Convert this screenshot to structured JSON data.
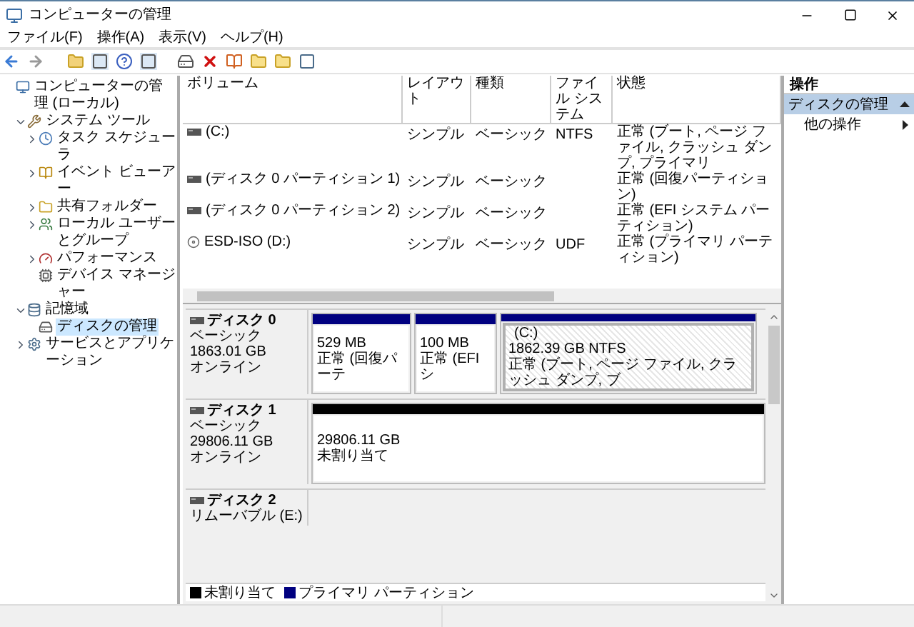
{
  "window": {
    "title": "コンピューターの管理"
  },
  "menu": [
    "ファイル(F)",
    "操作(A)",
    "表示(V)",
    "ヘルプ(H)"
  ],
  "tree": [
    {
      "label": "コンピューターの管理 (ローカル)",
      "selected": false,
      "children": [
        {
          "label": "システム ツール",
          "expanded": true,
          "selected": false,
          "children": [
            {
              "label": "タスク スケジューラ",
              "expanded": false,
              "selected": false
            },
            {
              "label": "イベント ビューアー",
              "expanded": false,
              "selected": false
            },
            {
              "label": "共有フォルダー",
              "expanded": false,
              "selected": false
            },
            {
              "label": "ローカル ユーザーとグループ",
              "expanded": false,
              "selected": false
            },
            {
              "label": "パフォーマンス",
              "expanded": false,
              "selected": false
            },
            {
              "label": "デバイス マネージャー",
              "selected": false
            }
          ]
        },
        {
          "label": "記憶域",
          "expanded": true,
          "selected": false,
          "children": [
            {
              "label": "ディスクの管理",
              "selected": true
            }
          ]
        },
        {
          "label": "サービスとアプリケーション",
          "expanded": false,
          "selected": false
        }
      ]
    }
  ],
  "volumes": {
    "columns": [
      "ボリューム",
      "レイアウト",
      "種類",
      "ファイル システム",
      "状態"
    ],
    "rows": [
      {
        "kind": "disk",
        "volume": "(C:)",
        "layout": "シンプル",
        "type": "ベーシック",
        "fs": "NTFS",
        "status": "正常 (ブート, ページ ファイル, クラッシュ ダンプ, プライマリ"
      },
      {
        "kind": "disk",
        "volume": "(ディスク 0 パーティション 1)",
        "layout": "シンプル",
        "type": "ベーシック",
        "status": "正常 (回復パーティション)"
      },
      {
        "kind": "disk",
        "volume": "(ディスク 0 パーティション 2)",
        "layout": "シンプル",
        "type": "ベーシック",
        "status": "正常 (EFI システム パーティション)"
      },
      {
        "kind": "cdrom",
        "volume": "ESD-ISO (D:)",
        "layout": "シンプル",
        "type": "ベーシック",
        "fs": "UDF",
        "status": "正常 (プライマリ パーティション)"
      }
    ]
  },
  "disks": [
    {
      "name": "ディスク 0",
      "type": "ベーシック",
      "size": "1863.01 GB",
      "status": "オンライン",
      "partitions": [
        {
          "kind": "primary",
          "size": "529 MB",
          "status": "正常 (回復パーテ",
          "selected": false
        },
        {
          "kind": "primary",
          "size": "100 MB",
          "status": "正常 (EFI シ",
          "selected": false
        },
        {
          "kind": "primary",
          "label": "(C:)",
          "size": "1862.39 GB NTFS",
          "status": "正常 (ブート, ページ ファイル, クラッシュ ダンプ, ブ",
          "selected": true
        }
      ]
    },
    {
      "name": "ディスク 1",
      "type": "ベーシック",
      "size": "29806.11 GB",
      "status": "オンライン",
      "partitions": [
        {
          "kind": "unallocated",
          "size": "29806.11 GB",
          "status": "未割り当て",
          "selected": false
        }
      ]
    },
    {
      "name": "ディスク 2",
      "type": "リムーバブル (E:)"
    }
  ],
  "legend": [
    {
      "kind": "unallocated",
      "label": "未割り当て",
      "color": "#000000"
    },
    {
      "kind": "primary",
      "label": "プライマリ パーティション",
      "color": "#000080"
    }
  ],
  "actions": {
    "title": "操作",
    "sections": [
      {
        "label": "ディスクの管理",
        "expanded": true,
        "items": [
          "他の操作"
        ]
      }
    ]
  }
}
